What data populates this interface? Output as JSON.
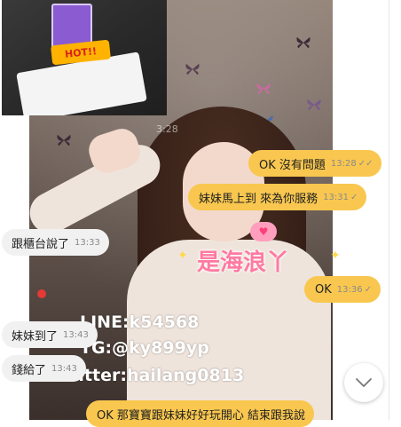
{
  "background_photo": {
    "overlay_lines": [
      "LINE:k54568",
      "TG:@ky899yp",
      "Twitter:hailang0813"
    ],
    "brand_text": "是海浪丫",
    "ghost_timestamp": "3:28",
    "inset": {
      "badge_text": "HOT!!"
    }
  },
  "messages": [
    {
      "dir": "out",
      "text": "OK 沒有問題",
      "time": "13:28",
      "read": true
    },
    {
      "dir": "out",
      "text": "妹妹馬上到 來為你服務",
      "time": "13:31",
      "read": true
    },
    {
      "dir": "in",
      "text": "跟櫃台說了",
      "time": "13:33"
    },
    {
      "dir": "out",
      "text": "OK",
      "time": "13:36",
      "read": true
    },
    {
      "dir": "in",
      "text": "妹妹到了",
      "time": "13:43"
    },
    {
      "dir": "in",
      "text": "錢給了",
      "time": "13:43"
    },
    {
      "dir": "out",
      "text": "OK 那寶寶跟妹妹好好玩開心 結束跟我說",
      "time": "",
      "read": false
    }
  ],
  "icons": {
    "check": "double-check-icon",
    "scroll": "chevron-down-icon"
  },
  "colors": {
    "outgoing_bubble": "#f9c74f",
    "incoming_bubble": "#f1f1f1",
    "brand_pink": "#ff7aa2"
  }
}
